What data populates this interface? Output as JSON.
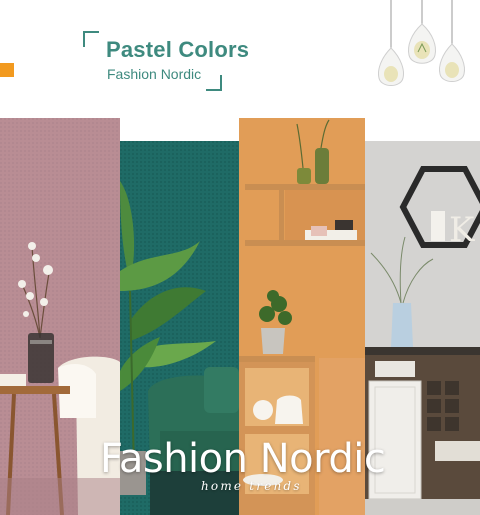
{
  "header": {
    "title": "Pastel Colors",
    "subtitle": "Fashion Nordic"
  },
  "banner": {
    "brand": "Fashion Nordic",
    "tagline": "home trends"
  },
  "colors": {
    "accent_orange": "#f29a1f",
    "title_green": "#3e8a7f",
    "panel_pink": "#b98d94",
    "panel_teal": "#1f6b66",
    "panel_orange": "#e19d57",
    "panel_grey": "#d4d3d1"
  },
  "icons": [
    "pendant-lamp-icon"
  ]
}
